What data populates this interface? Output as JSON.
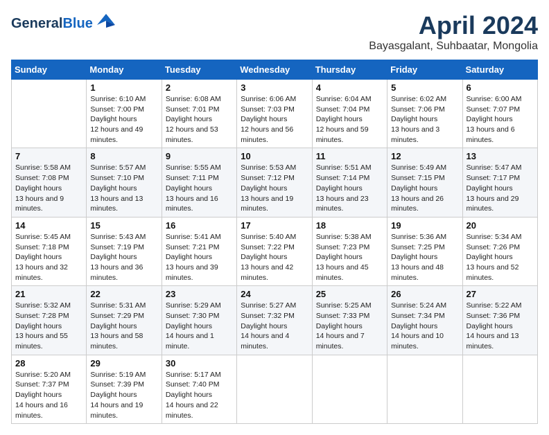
{
  "header": {
    "logo_line1": "General",
    "logo_line2": "Blue",
    "month_title": "April 2024",
    "location": "Bayasgalant, Suhbaatar, Mongolia"
  },
  "weekdays": [
    "Sunday",
    "Monday",
    "Tuesday",
    "Wednesday",
    "Thursday",
    "Friday",
    "Saturday"
  ],
  "weeks": [
    [
      {
        "day": null
      },
      {
        "day": "1",
        "sunrise": "6:10 AM",
        "sunset": "7:00 PM",
        "daylight": "12 hours and 49 minutes."
      },
      {
        "day": "2",
        "sunrise": "6:08 AM",
        "sunset": "7:01 PM",
        "daylight": "12 hours and 53 minutes."
      },
      {
        "day": "3",
        "sunrise": "6:06 AM",
        "sunset": "7:03 PM",
        "daylight": "12 hours and 56 minutes."
      },
      {
        "day": "4",
        "sunrise": "6:04 AM",
        "sunset": "7:04 PM",
        "daylight": "12 hours and 59 minutes."
      },
      {
        "day": "5",
        "sunrise": "6:02 AM",
        "sunset": "7:06 PM",
        "daylight": "13 hours and 3 minutes."
      },
      {
        "day": "6",
        "sunrise": "6:00 AM",
        "sunset": "7:07 PM",
        "daylight": "13 hours and 6 minutes."
      }
    ],
    [
      {
        "day": "7",
        "sunrise": "5:58 AM",
        "sunset": "7:08 PM",
        "daylight": "13 hours and 9 minutes."
      },
      {
        "day": "8",
        "sunrise": "5:57 AM",
        "sunset": "7:10 PM",
        "daylight": "13 hours and 13 minutes."
      },
      {
        "day": "9",
        "sunrise": "5:55 AM",
        "sunset": "7:11 PM",
        "daylight": "13 hours and 16 minutes."
      },
      {
        "day": "10",
        "sunrise": "5:53 AM",
        "sunset": "7:12 PM",
        "daylight": "13 hours and 19 minutes."
      },
      {
        "day": "11",
        "sunrise": "5:51 AM",
        "sunset": "7:14 PM",
        "daylight": "13 hours and 23 minutes."
      },
      {
        "day": "12",
        "sunrise": "5:49 AM",
        "sunset": "7:15 PM",
        "daylight": "13 hours and 26 minutes."
      },
      {
        "day": "13",
        "sunrise": "5:47 AM",
        "sunset": "7:17 PM",
        "daylight": "13 hours and 29 minutes."
      }
    ],
    [
      {
        "day": "14",
        "sunrise": "5:45 AM",
        "sunset": "7:18 PM",
        "daylight": "13 hours and 32 minutes."
      },
      {
        "day": "15",
        "sunrise": "5:43 AM",
        "sunset": "7:19 PM",
        "daylight": "13 hours and 36 minutes."
      },
      {
        "day": "16",
        "sunrise": "5:41 AM",
        "sunset": "7:21 PM",
        "daylight": "13 hours and 39 minutes."
      },
      {
        "day": "17",
        "sunrise": "5:40 AM",
        "sunset": "7:22 PM",
        "daylight": "13 hours and 42 minutes."
      },
      {
        "day": "18",
        "sunrise": "5:38 AM",
        "sunset": "7:23 PM",
        "daylight": "13 hours and 45 minutes."
      },
      {
        "day": "19",
        "sunrise": "5:36 AM",
        "sunset": "7:25 PM",
        "daylight": "13 hours and 48 minutes."
      },
      {
        "day": "20",
        "sunrise": "5:34 AM",
        "sunset": "7:26 PM",
        "daylight": "13 hours and 52 minutes."
      }
    ],
    [
      {
        "day": "21",
        "sunrise": "5:32 AM",
        "sunset": "7:28 PM",
        "daylight": "13 hours and 55 minutes."
      },
      {
        "day": "22",
        "sunrise": "5:31 AM",
        "sunset": "7:29 PM",
        "daylight": "13 hours and 58 minutes."
      },
      {
        "day": "23",
        "sunrise": "5:29 AM",
        "sunset": "7:30 PM",
        "daylight": "14 hours and 1 minute."
      },
      {
        "day": "24",
        "sunrise": "5:27 AM",
        "sunset": "7:32 PM",
        "daylight": "14 hours and 4 minutes."
      },
      {
        "day": "25",
        "sunrise": "5:25 AM",
        "sunset": "7:33 PM",
        "daylight": "14 hours and 7 minutes."
      },
      {
        "day": "26",
        "sunrise": "5:24 AM",
        "sunset": "7:34 PM",
        "daylight": "14 hours and 10 minutes."
      },
      {
        "day": "27",
        "sunrise": "5:22 AM",
        "sunset": "7:36 PM",
        "daylight": "14 hours and 13 minutes."
      }
    ],
    [
      {
        "day": "28",
        "sunrise": "5:20 AM",
        "sunset": "7:37 PM",
        "daylight": "14 hours and 16 minutes."
      },
      {
        "day": "29",
        "sunrise": "5:19 AM",
        "sunset": "7:39 PM",
        "daylight": "14 hours and 19 minutes."
      },
      {
        "day": "30",
        "sunrise": "5:17 AM",
        "sunset": "7:40 PM",
        "daylight": "14 hours and 22 minutes."
      },
      {
        "day": null
      },
      {
        "day": null
      },
      {
        "day": null
      },
      {
        "day": null
      }
    ]
  ],
  "labels": {
    "sunrise": "Sunrise:",
    "sunset": "Sunset:",
    "daylight": "Daylight hours"
  }
}
